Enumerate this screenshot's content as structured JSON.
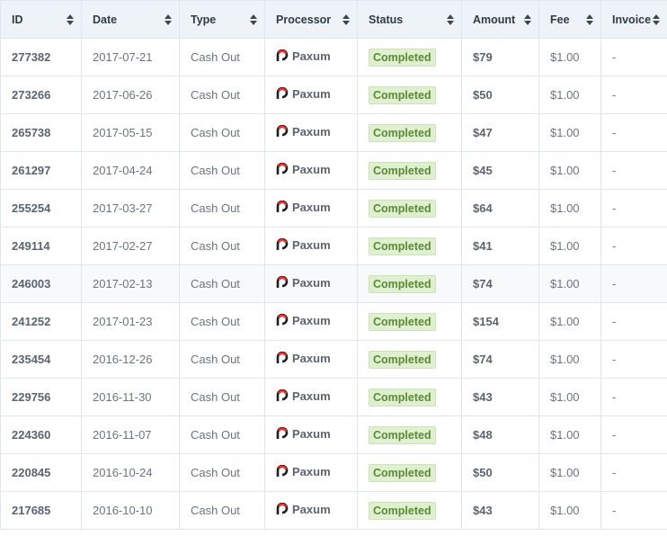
{
  "columns": [
    {
      "key": "id",
      "label": "ID"
    },
    {
      "key": "date",
      "label": "Date"
    },
    {
      "key": "type",
      "label": "Type"
    },
    {
      "key": "processor",
      "label": "Processor"
    },
    {
      "key": "status",
      "label": "Status"
    },
    {
      "key": "amount",
      "label": "Amount"
    },
    {
      "key": "fee",
      "label": "Fee"
    },
    {
      "key": "invoice",
      "label": "Invoice"
    }
  ],
  "rows": [
    {
      "id": "277382",
      "date": "2017-07-21",
      "type": "Cash Out",
      "processor": "Paxum",
      "status": "Completed",
      "amount": "$79",
      "fee": "$1.00",
      "invoice": "-"
    },
    {
      "id": "273266",
      "date": "2017-06-26",
      "type": "Cash Out",
      "processor": "Paxum",
      "status": "Completed",
      "amount": "$50",
      "fee": "$1.00",
      "invoice": "-"
    },
    {
      "id": "265738",
      "date": "2017-05-15",
      "type": "Cash Out",
      "processor": "Paxum",
      "status": "Completed",
      "amount": "$47",
      "fee": "$1.00",
      "invoice": "-"
    },
    {
      "id": "261297",
      "date": "2017-04-24",
      "type": "Cash Out",
      "processor": "Paxum",
      "status": "Completed",
      "amount": "$45",
      "fee": "$1.00",
      "invoice": "-"
    },
    {
      "id": "255254",
      "date": "2017-03-27",
      "type": "Cash Out",
      "processor": "Paxum",
      "status": "Completed",
      "amount": "$64",
      "fee": "$1.00",
      "invoice": "-"
    },
    {
      "id": "249114",
      "date": "2017-02-27",
      "type": "Cash Out",
      "processor": "Paxum",
      "status": "Completed",
      "amount": "$41",
      "fee": "$1.00",
      "invoice": "-"
    },
    {
      "id": "246003",
      "date": "2017-02-13",
      "type": "Cash Out",
      "processor": "Paxum",
      "status": "Completed",
      "amount": "$74",
      "fee": "$1.00",
      "invoice": "-"
    },
    {
      "id": "241252",
      "date": "2017-01-23",
      "type": "Cash Out",
      "processor": "Paxum",
      "status": "Completed",
      "amount": "$154",
      "fee": "$1.00",
      "invoice": "-"
    },
    {
      "id": "235454",
      "date": "2016-12-26",
      "type": "Cash Out",
      "processor": "Paxum",
      "status": "Completed",
      "amount": "$74",
      "fee": "$1.00",
      "invoice": "-"
    },
    {
      "id": "229756",
      "date": "2016-11-30",
      "type": "Cash Out",
      "processor": "Paxum",
      "status": "Completed",
      "amount": "$43",
      "fee": "$1.00",
      "invoice": "-"
    },
    {
      "id": "224360",
      "date": "2016-11-07",
      "type": "Cash Out",
      "processor": "Paxum",
      "status": "Completed",
      "amount": "$48",
      "fee": "$1.00",
      "invoice": "-"
    },
    {
      "id": "220845",
      "date": "2016-10-24",
      "type": "Cash Out",
      "processor": "Paxum",
      "status": "Completed",
      "amount": "$50",
      "fee": "$1.00",
      "invoice": "-"
    },
    {
      "id": "217685",
      "date": "2016-10-10",
      "type": "Cash Out",
      "processor": "Paxum",
      "status": "Completed",
      "amount": "$43",
      "fee": "$1.00",
      "invoice": "-"
    }
  ],
  "highlight_row_index": 6,
  "icons": {
    "sort": "sort-icon",
    "processor_logo": "paxum-logo-icon"
  },
  "colors": {
    "header_bg": "#eef3f7",
    "border": "#dfe6ec",
    "status_completed_bg": "#dff0d2",
    "status_completed_text": "#5c8a33",
    "paxum_red": "#e8352b",
    "paxum_dark": "#1f1f1f"
  }
}
